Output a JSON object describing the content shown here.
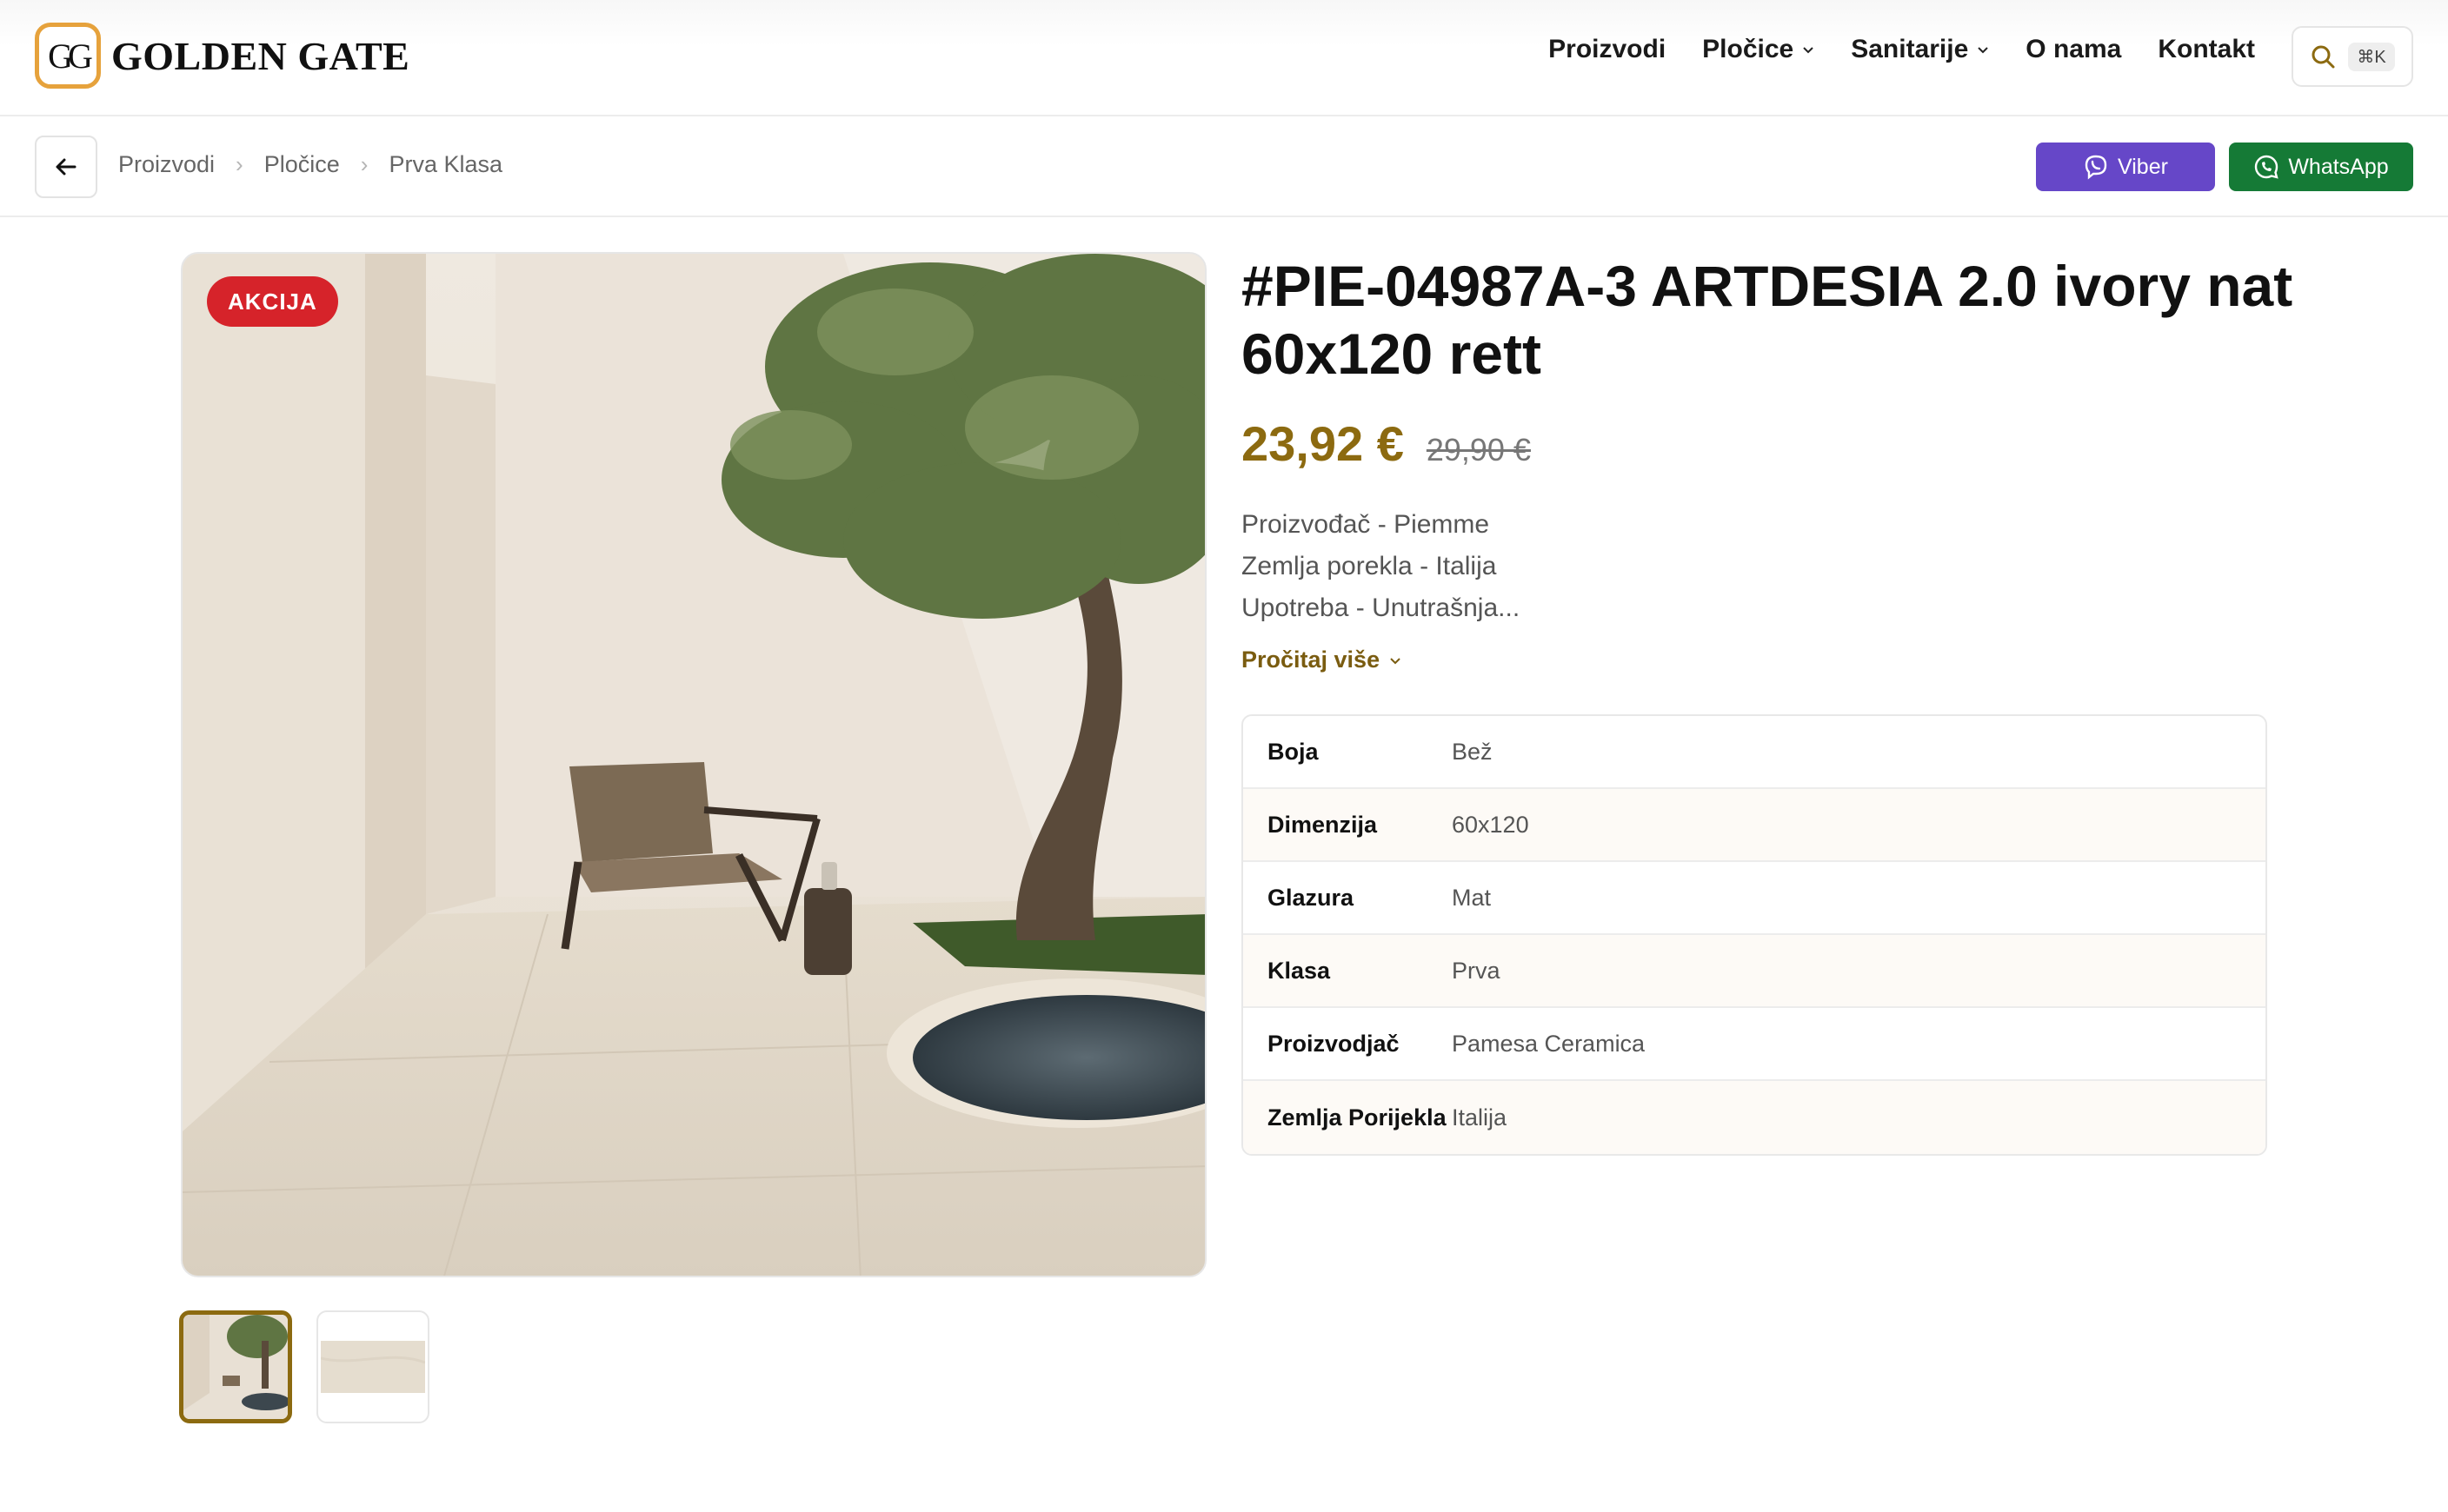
{
  "brand": {
    "logo_monogram": "GG",
    "name": "GOLDEN GATE",
    "accent": "#e6a23c"
  },
  "nav": {
    "items": [
      {
        "label": "Proizvodi",
        "dropdown": false
      },
      {
        "label": "Pločice",
        "dropdown": true
      },
      {
        "label": "Sanitarije",
        "dropdown": true
      },
      {
        "label": "O nama",
        "dropdown": false
      },
      {
        "label": "Kontakt",
        "dropdown": false
      }
    ],
    "search_shortcut": "⌘K",
    "icons": [
      "search-icon",
      "chevron-down-icon"
    ]
  },
  "breadcrumb": {
    "items": [
      "Proizvodi",
      "Pločice",
      "Prva Klasa"
    ],
    "back_icon": "arrow-left-icon"
  },
  "contact": {
    "viber_label": "Viber",
    "viber_color": "#6647c8",
    "whatsapp_label": "WhatsApp",
    "whatsapp_color": "#157a36"
  },
  "product": {
    "badge": "AKCIJA",
    "badge_color": "#d6232a",
    "title": "#PIE-04987A-3 ARTDESIA 2.0 ivory nat 60x120 rett",
    "price": "23,92 €",
    "old_price": "29,90 €",
    "price_color": "#8c6a10",
    "description_lines": [
      "Proizvođač - Piemme",
      "Zemlja porekla - Italija",
      "Upotreba - Unutrašnja..."
    ],
    "read_more": "Pročitaj više",
    "specs": [
      {
        "label": "Boja",
        "value": "Bež"
      },
      {
        "label": "Dimenzija",
        "value": "60x120"
      },
      {
        "label": "Glazura",
        "value": "Mat"
      },
      {
        "label": "Klasa",
        "value": "Prva"
      },
      {
        "label": "Proizvodjač",
        "value": "Pamesa Ceramica"
      },
      {
        "label": "Zemlja Porijekla",
        "value": "Italija"
      }
    ],
    "thumbnail_count": 2,
    "selected_thumbnail": 1
  }
}
